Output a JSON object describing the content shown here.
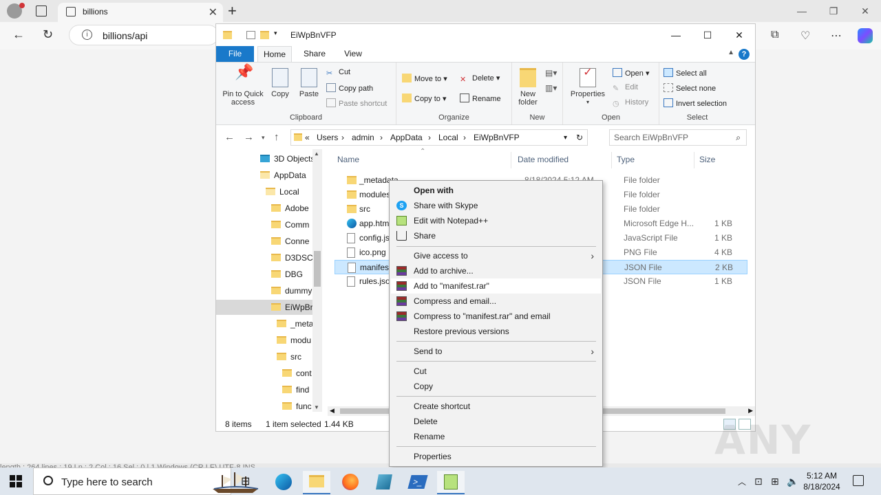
{
  "browser": {
    "tab_title": "billions",
    "address": "billions/api"
  },
  "explorer": {
    "title": "EiWpBnVFP",
    "ribbon_tabs": [
      "File",
      "Home",
      "Share",
      "View"
    ],
    "clipboard": {
      "pin": "Pin to Quick access",
      "copy": "Copy",
      "paste": "Paste",
      "cut": "Cut",
      "copy_path": "Copy path",
      "paste_shortcut": "Paste shortcut",
      "label": "Clipboard"
    },
    "organize": {
      "move_to": "Move to",
      "copy_to": "Copy to",
      "delete": "Delete",
      "rename": "Rename",
      "label": "Organize"
    },
    "new": {
      "new_folder": "New folder",
      "label": "New"
    },
    "open": {
      "properties": "Properties",
      "open": "Open",
      "edit": "Edit",
      "history": "History",
      "label": "Open"
    },
    "select": {
      "select_all": "Select all",
      "select_none": "Select none",
      "invert": "Invert selection",
      "label": "Select"
    },
    "breadcrumb": [
      "«",
      "Users",
      "admin",
      "AppData",
      "Local",
      "EiWpBnVFP"
    ],
    "search_placeholder": "Search EiWpBnVFP",
    "tree": [
      {
        "label": "3D Objects"
      },
      {
        "label": "AppData"
      },
      {
        "label": "Local"
      },
      {
        "label": "Adobe"
      },
      {
        "label": "Comm"
      },
      {
        "label": "Conne"
      },
      {
        "label": "D3DSC"
      },
      {
        "label": "DBG"
      },
      {
        "label": "dummy"
      },
      {
        "label": "EiWpBr"
      },
      {
        "label": "_meta"
      },
      {
        "label": "modu"
      },
      {
        "label": "src"
      },
      {
        "label": "cont"
      },
      {
        "label": "find"
      },
      {
        "label": "func"
      }
    ],
    "columns": [
      "Name",
      "Date modified",
      "Type",
      "Size"
    ],
    "files": [
      {
        "name": "_metadata",
        "date": "8/18/2024 5:12 AM",
        "type": "File folder",
        "size": "",
        "icon": "folder"
      },
      {
        "name": "modules",
        "date": "",
        "type": "File folder",
        "size": "",
        "icon": "folder"
      },
      {
        "name": "src",
        "date": "",
        "type": "File folder",
        "size": "",
        "icon": "folder"
      },
      {
        "name": "app.html",
        "date": "",
        "type": "Microsoft Edge H...",
        "size": "1 KB",
        "icon": "edge"
      },
      {
        "name": "config.js",
        "date": "",
        "type": "JavaScript File",
        "size": "1 KB",
        "icon": "doc"
      },
      {
        "name": "ico.png",
        "date": "",
        "type": "PNG File",
        "size": "4 KB",
        "icon": "doc"
      },
      {
        "name": "manifest.js",
        "date": "",
        "type": "JSON File",
        "size": "2 KB",
        "icon": "doc"
      },
      {
        "name": "rules.json",
        "date": "",
        "type": "JSON File",
        "size": "1 KB",
        "icon": "doc"
      }
    ],
    "status": {
      "items": "8 items",
      "selected": "1 item selected",
      "size": "1.44 KB"
    }
  },
  "context_menu": {
    "open_with": "Open with",
    "share_skype": "Share with Skype",
    "edit_npp": "Edit with Notepad++",
    "share": "Share",
    "give_access": "Give access to",
    "add_archive": "Add to archive...",
    "add_rar": "Add to \"manifest.rar\"",
    "compress_email": "Compress and email...",
    "compress_rar_email": "Compress to \"manifest.rar\" and email",
    "restore": "Restore previous versions",
    "send_to": "Send to",
    "cut": "Cut",
    "copy": "Copy",
    "create_shortcut": "Create shortcut",
    "delete": "Delete",
    "rename": "Rename",
    "properties": "Properties"
  },
  "background_status": "length : 264    lines : 19                                    Ln : 2    Col : 16    Sel : 0 | 1                                Windows (CR LF)            UTF-8                                                                          INS",
  "taskbar": {
    "search_placeholder": "Type here to search",
    "time": "5:12 AM",
    "date": "8/18/2024"
  },
  "watermark": "ANY RUN"
}
